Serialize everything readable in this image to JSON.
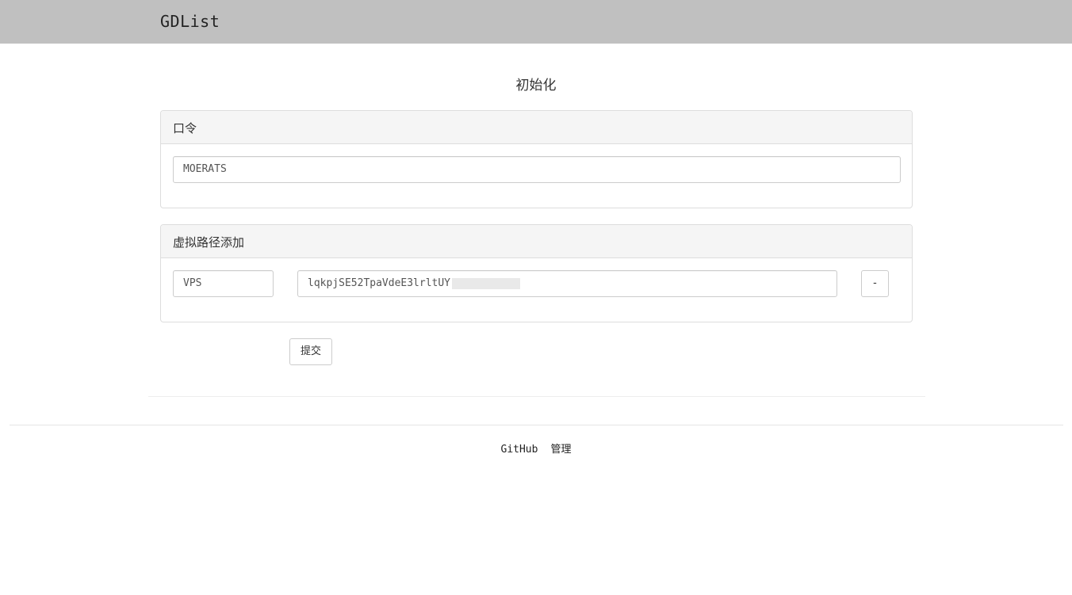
{
  "header": {
    "brand": "GDList"
  },
  "page": {
    "title": "初始化"
  },
  "password_panel": {
    "heading": "口令",
    "value": "MOERATS"
  },
  "virtual_path_panel": {
    "heading": "虚拟路径添加",
    "name_value": "VPS",
    "id_value": "lqkpjSE52TpaVdeE3lrltUY",
    "remove_label": "-"
  },
  "form": {
    "submit_label": "提交"
  },
  "footer": {
    "github_label": "GitHub",
    "admin_label": "管理"
  }
}
